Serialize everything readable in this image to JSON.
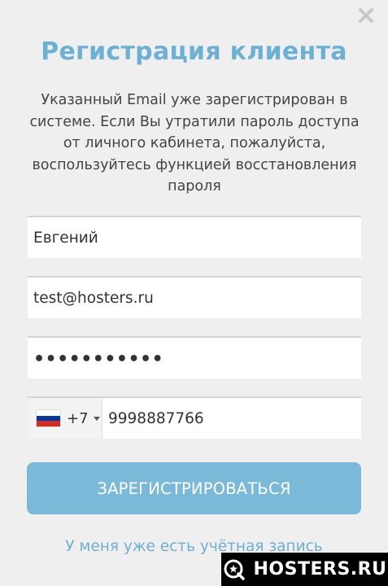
{
  "dialog": {
    "title": "Регистрация клиента",
    "message": "Указанный Email уже зарегистрирован в системе. Если Вы утратили пароль доступа от личного кабинета, пожалуйста, воспользуйтесь функцией восстановления пароля",
    "close_icon": "close-icon"
  },
  "form": {
    "name_value": "Евгений",
    "email_value": "test@hosters.ru",
    "password_masked": "•••••••••••",
    "phone": {
      "country_flag": "russia-flag-icon",
      "dial_code": "+7",
      "number": "9998887766",
      "flag_colors": [
        "#ffffff",
        "#0039a6",
        "#d52b1e"
      ]
    },
    "submit_label": "ЗАРЕГИСТРИРОВАТЬСЯ",
    "login_link": "У меня уже есть учётная запись"
  },
  "watermark": {
    "text": "HOSTERS.RU",
    "icon": "hosters-logo-icon"
  },
  "colors": {
    "accent": "#6cb0d4",
    "button": "#7ab9d7",
    "background": "#efefef"
  }
}
